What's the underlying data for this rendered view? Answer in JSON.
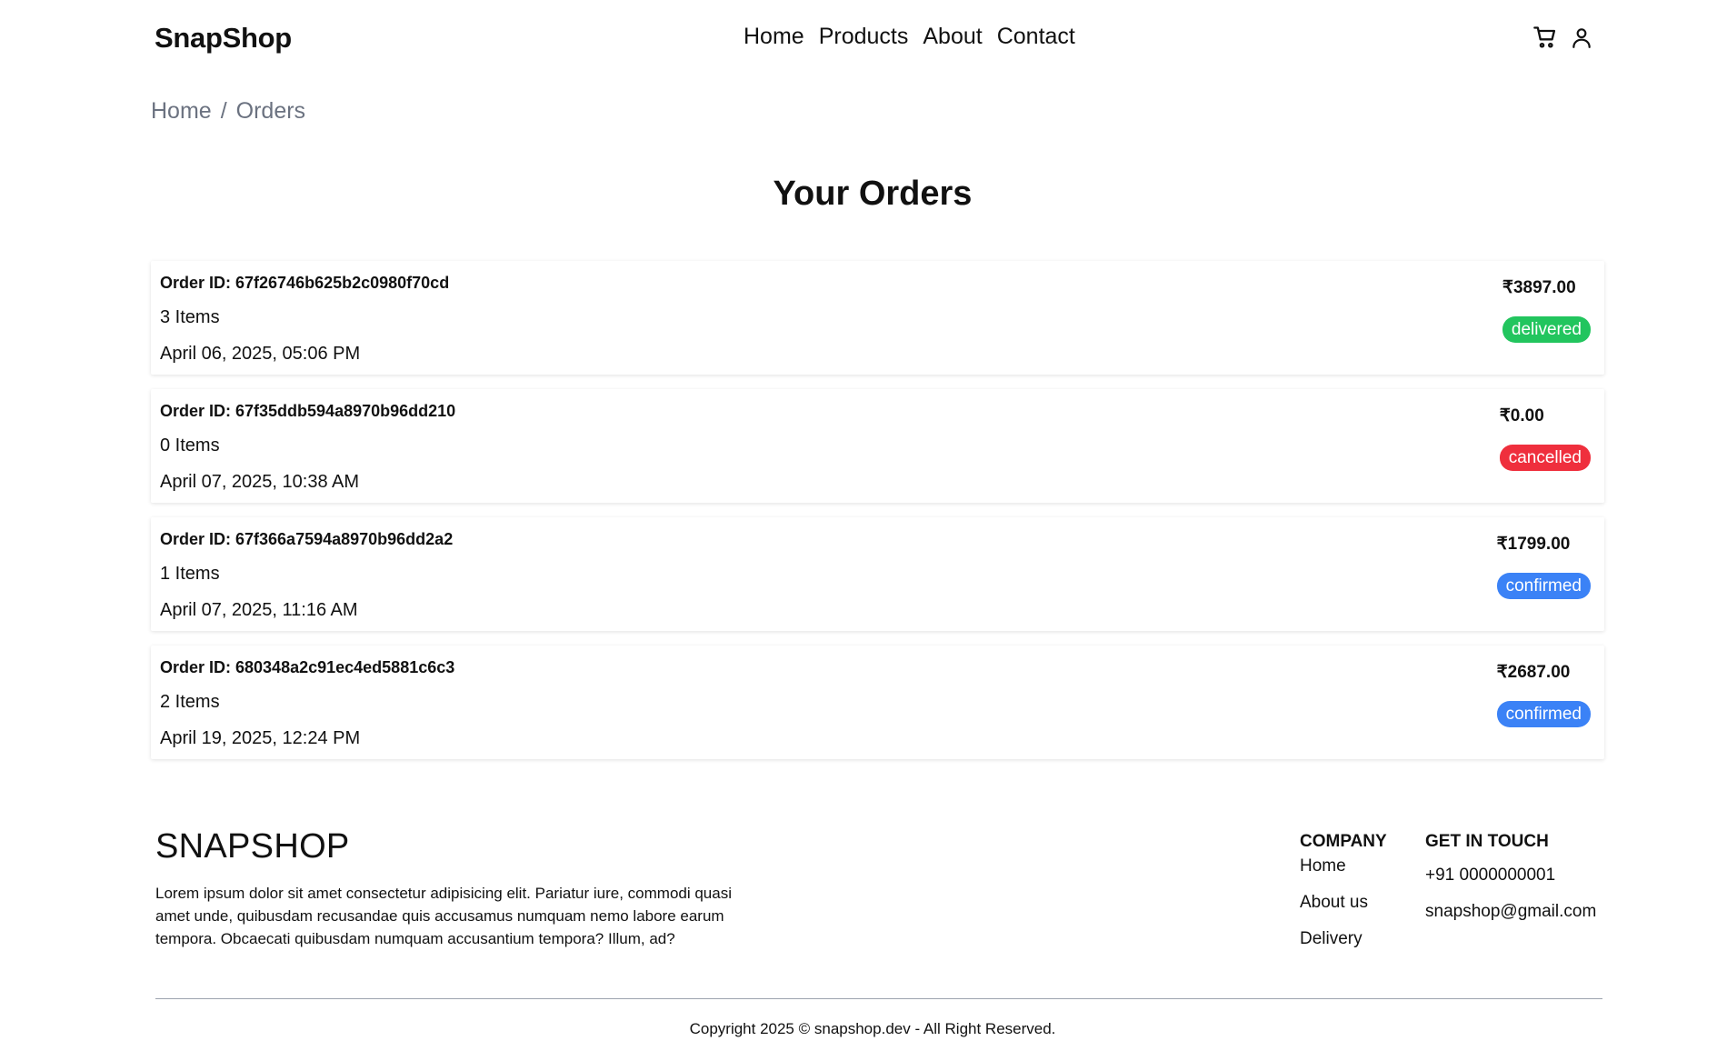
{
  "header": {
    "logo": "SnapShop",
    "nav": [
      "Home",
      "Products",
      "About",
      "Contact"
    ],
    "icons": [
      "cart-icon",
      "user-icon"
    ]
  },
  "breadcrumb": [
    "Home",
    "/",
    "Orders"
  ],
  "page_title": "Your Orders",
  "orders": [
    {
      "id": "Order ID: 67f26746b625b2c0980f70cd",
      "items": "3 Items",
      "date": "April 06, 2025, 05:06 PM",
      "price": "₹3897.00",
      "status": "delivered",
      "status_color": "#22c55e"
    },
    {
      "id": "Order ID: 67f35ddb594a8970b96dd210",
      "items": "0 Items",
      "date": "April 07, 2025, 10:38 AM",
      "price": "₹0.00",
      "status": "cancelled",
      "status_color": "#ef2f3d"
    },
    {
      "id": "Order ID: 67f366a7594a8970b96dd2a2",
      "items": "1 Items",
      "date": "April 07, 2025, 11:16 AM",
      "price": "₹1799.00",
      "status": "confirmed",
      "status_color": "#3b82f6"
    },
    {
      "id": "Order ID: 680348a2c91ec4ed5881c6c3",
      "items": "2 Items",
      "date": "April 19, 2025, 12:24 PM",
      "price": "₹2687.00",
      "status": "confirmed",
      "status_color": "#3b82f6"
    }
  ],
  "footer": {
    "brand": "SNAPSHOP",
    "description": "Lorem ipsum dolor sit amet consectetur adipisicing elit. Pariatur iure, commodi quasi amet unde, quibusdam recusandae quis accusamus numquam nemo labore earum tempora. Obcaecati quibusdam numquam accusantium tempora? Illum, ad?",
    "company": {
      "heading": "COMPANY",
      "links": [
        "Home",
        "About us",
        "Delivery"
      ]
    },
    "contact": {
      "heading": "GET IN TOUCH",
      "phone": "+91 0000000001",
      "email": "snapshop@gmail.com"
    },
    "copyright": "Copyright 2025 © snapshop.dev - All Right Reserved."
  }
}
